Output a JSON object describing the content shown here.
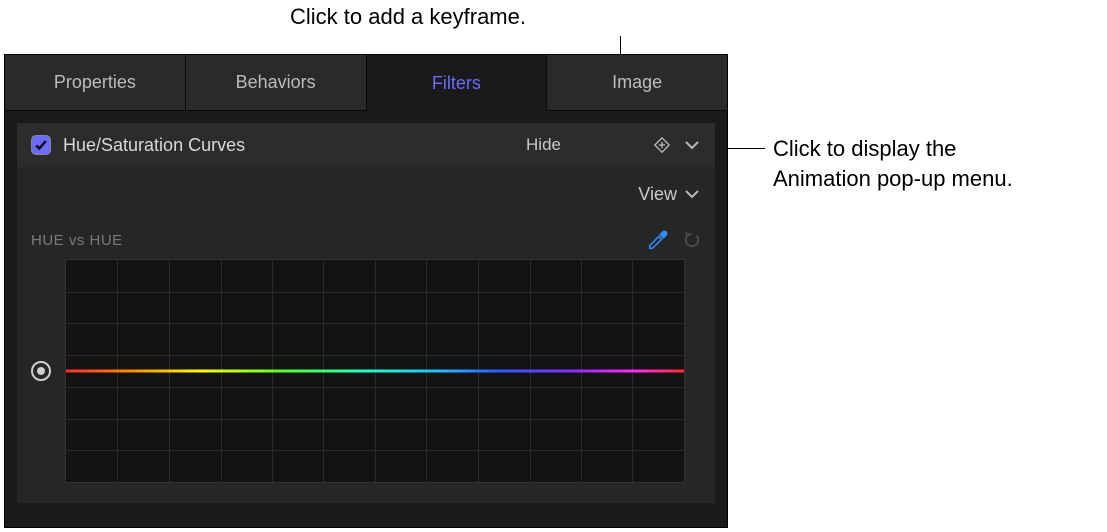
{
  "annotations": {
    "top": "Click to add a keyframe.",
    "right_line1": "Click to display the",
    "right_line2": "Animation pop-up menu."
  },
  "tabs": {
    "properties": "Properties",
    "behaviors": "Behaviors",
    "filters": "Filters",
    "image": "Image"
  },
  "filter_header": {
    "title": "Hue/Saturation Curves",
    "hide": "Hide"
  },
  "view_menu": {
    "label": "View"
  },
  "curve": {
    "label": "HUE vs HUE"
  }
}
